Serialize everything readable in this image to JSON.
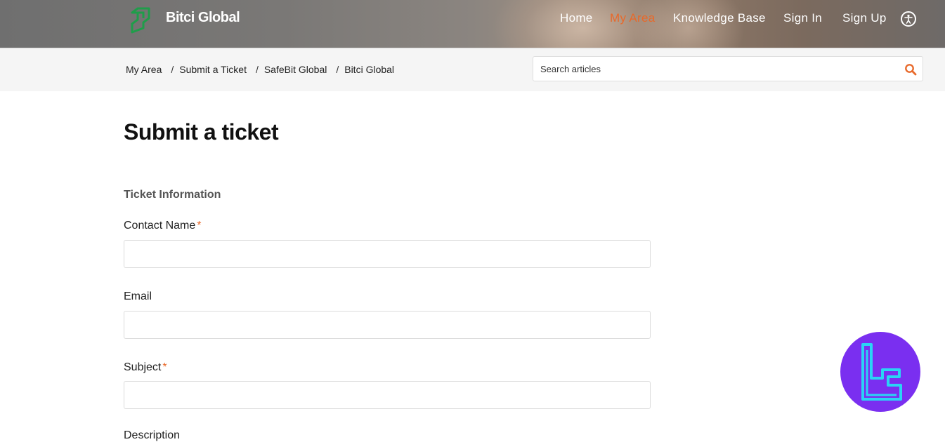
{
  "header": {
    "brand": "Bitci Global",
    "nav": [
      {
        "label": "Home",
        "active": false
      },
      {
        "label": "My Area",
        "active": true
      },
      {
        "label": "Knowledge Base",
        "active": false
      },
      {
        "label": "Sign In",
        "active": false
      },
      {
        "label": "Sign Up",
        "active": false
      }
    ],
    "accent_color": "#e8692a",
    "logo_color": "#1f9d4a",
    "accessibility_icon": "accessibility-icon"
  },
  "breadcrumb": [
    "My Area",
    "Submit a Ticket",
    "SafeBit Global",
    "Bitci Global"
  ],
  "search": {
    "placeholder": "Search articles",
    "icon": "search-icon"
  },
  "main": {
    "title": "Submit a ticket",
    "section_title": "Ticket Information",
    "fields": [
      {
        "label": "Contact Name",
        "required": true,
        "value": ""
      },
      {
        "label": "Email",
        "required": false,
        "value": ""
      },
      {
        "label": "Subject",
        "required": true,
        "value": ""
      }
    ],
    "next_label_partial": "Description"
  },
  "badge": {
    "color": "#7a2ff0",
    "icon": "tc-logo-icon"
  }
}
